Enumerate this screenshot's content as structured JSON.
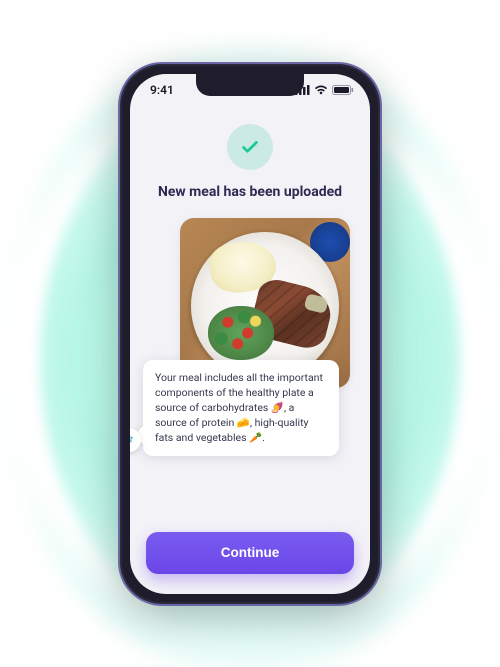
{
  "status_bar": {
    "time": "9:41"
  },
  "screen": {
    "heading": "New meal has been uploaded",
    "meal_description": "Your meal includes all the important components of the healthy plate a source of carbohydrates 🍠, a source of protein 🧀, high-quality fats and vegetables 🥕.",
    "continue_label": "Continue"
  },
  "colors": {
    "accent_purple": "#6a46e7",
    "success_green": "#1bc997",
    "glow_green": "#3fe8c0"
  }
}
